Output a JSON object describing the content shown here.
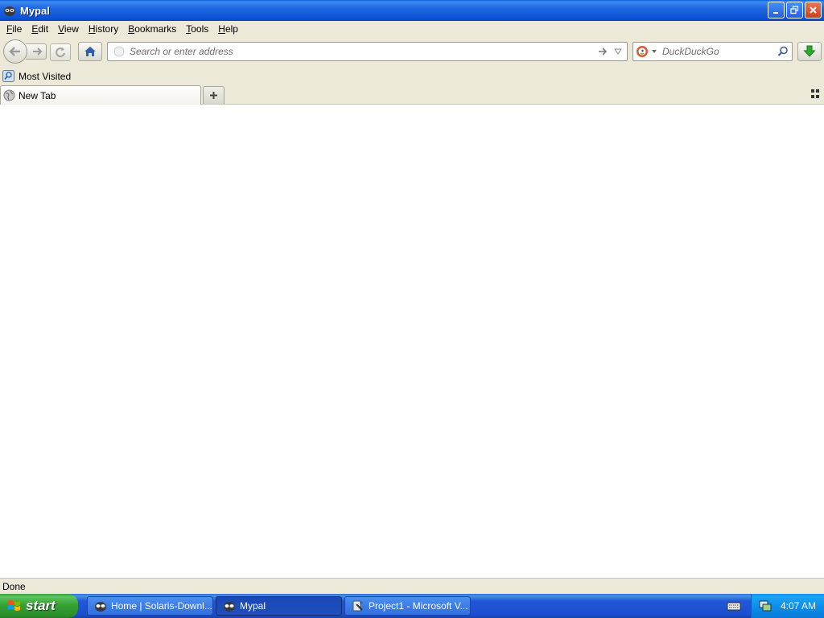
{
  "window": {
    "title": "Mypal"
  },
  "menu": [
    {
      "label": "File",
      "ul": "F",
      "rest": "ile"
    },
    {
      "label": "Edit",
      "ul": "E",
      "rest": "dit"
    },
    {
      "label": "View",
      "ul": "V",
      "rest": "iew"
    },
    {
      "label": "History",
      "ul": "H",
      "rest": "istory"
    },
    {
      "label": "Bookmarks",
      "ul": "B",
      "rest": "ookmarks"
    },
    {
      "label": "Tools",
      "ul": "T",
      "rest": "ools"
    },
    {
      "label": "Help",
      "ul": "H",
      "rest": "elp"
    }
  ],
  "urlbar": {
    "placeholder": "Search or enter address",
    "value": ""
  },
  "searchbar": {
    "placeholder": "DuckDuckGo",
    "engine_icon": "duckduckgo-icon"
  },
  "bookmarks": {
    "items": [
      {
        "label": "Most Visited",
        "icon": "most-visited-icon"
      }
    ]
  },
  "tabs": [
    {
      "label": "New Tab",
      "icon": "globe-icon"
    }
  ],
  "status": {
    "text": "Done"
  },
  "taskbar": {
    "start_label": "start",
    "tasks": [
      {
        "label": "Home | Solaris-Downl...",
        "icon": "mypal-icon",
        "active": false
      },
      {
        "label": "Mypal",
        "icon": "mypal-icon",
        "active": true
      },
      {
        "label": "Project1 - Microsoft V...",
        "icon": "visual-basic-icon",
        "active": false
      }
    ],
    "clock": "4:07 AM"
  },
  "colors": {
    "titlebar": "#0b53d6",
    "taskbar": "#1c4fd0",
    "start": "#35a334",
    "tray": "#0c8ae8"
  }
}
